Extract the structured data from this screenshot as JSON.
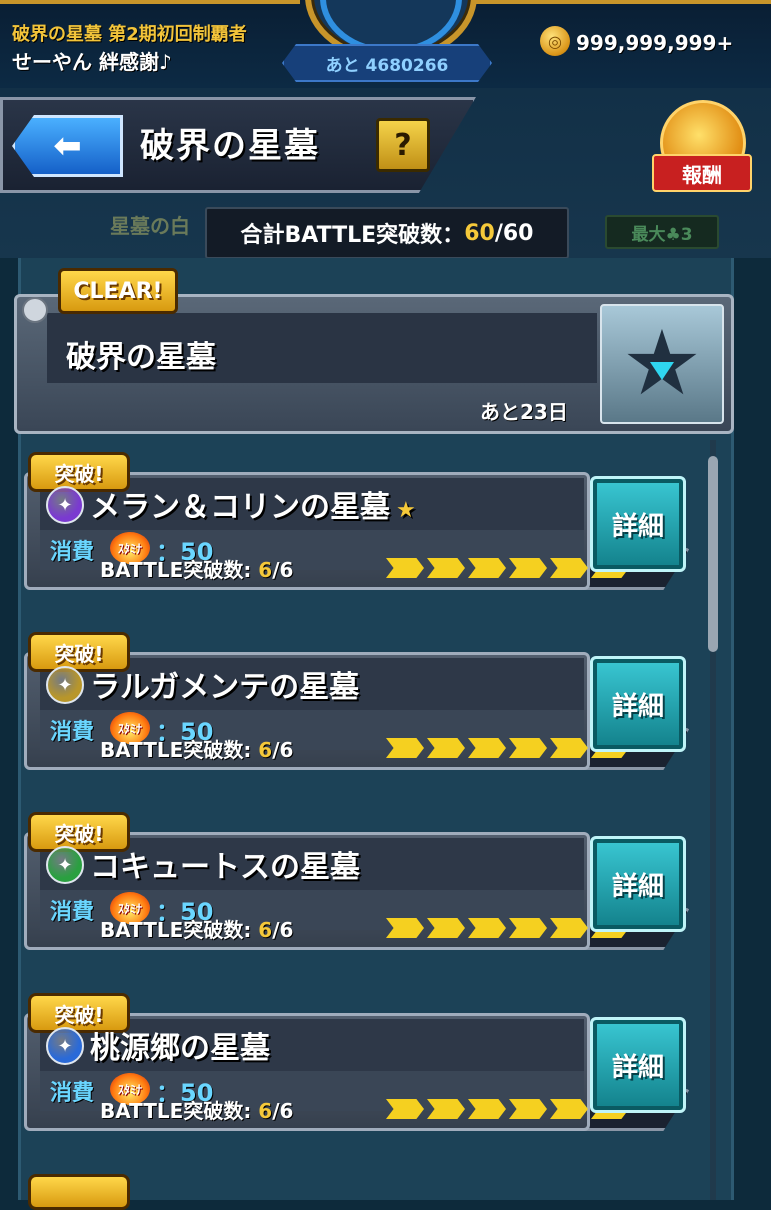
{
  "status_bar": {
    "user_title": "破界の星墓 第2期初回制覇者",
    "user_name": "せーやん 絆感謝♪",
    "exp_remaining": "あと 4680266",
    "coin_value": "999,999,999+",
    "coin_icon": "coin-icon"
  },
  "header": {
    "back_icon": "back-arrow-icon",
    "title": "破界の星墓",
    "help_label": "?",
    "reward_label": "報酬",
    "total_label": "合計BATTLE突破数：",
    "total_current": "60",
    "total_max": "/60",
    "background_text": "星墓の白",
    "background_max": "最大♣3"
  },
  "area": {
    "clear_label": "CLEAR!",
    "name": "破界の星墓",
    "days_left": "あと23日"
  },
  "stages": [
    {
      "badge": "突破!",
      "name": "メラン＆コリンの星墓",
      "star": "★",
      "element": "dark",
      "element_color": "#7a3ad0",
      "cost_label": "消費",
      "stamina_label": "ｽﾀﾐﾅ",
      "cost_value": "：50",
      "battle_label": "BATTLE突破数: ",
      "battle_current": "6",
      "battle_max": "/6",
      "progress": 1.0,
      "detail_label": "詳細"
    },
    {
      "badge": "突破!",
      "name": "ラルガメンテの星墓",
      "star": "",
      "element": "light",
      "element_color": "#b8962a",
      "cost_label": "消費",
      "stamina_label": "ｽﾀﾐﾅ",
      "cost_value": "：50",
      "battle_label": "BATTLE突破数: ",
      "battle_current": "6",
      "battle_max": "/6",
      "progress": 1.0,
      "detail_label": "詳細"
    },
    {
      "badge": "突破!",
      "name": "コキュートスの星墓",
      "star": "",
      "element": "wood",
      "element_color": "#2aa040",
      "cost_label": "消費",
      "stamina_label": "ｽﾀﾐﾅ",
      "cost_value": "：50",
      "battle_label": "BATTLE突破数: ",
      "battle_current": "6",
      "battle_max": "/6",
      "progress": 1.0,
      "detail_label": "詳細"
    },
    {
      "badge": "突破!",
      "name": "桃源郷の星墓",
      "star": "",
      "element": "water",
      "element_color": "#2a6ad8",
      "cost_label": "消費",
      "stamina_label": "ｽﾀﾐﾅ",
      "cost_value": "：50",
      "battle_label": "BATTLE突破数: ",
      "battle_current": "6",
      "battle_max": "/6",
      "progress": 1.0,
      "detail_label": "詳細"
    }
  ]
}
